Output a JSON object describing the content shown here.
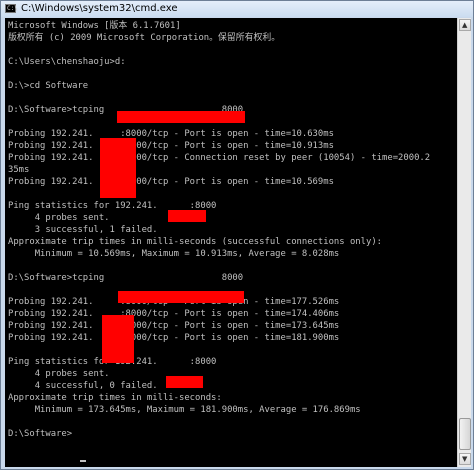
{
  "window": {
    "title": "C:\\Windows\\system32\\cmd.exe",
    "icon_label": "C:\\"
  },
  "console": {
    "lines": [
      "Microsoft Windows [版本 6.1.7601]",
      "版权所有 (c) 2009 Microsoft Corporation。保留所有权利。",
      "",
      "C:\\Users\\chenshaoju>d:",
      "",
      "D:\\>cd Software",
      "",
      "D:\\Software>tcping                      8000",
      "",
      "Probing 192.241.     :8000/tcp - Port is open - time=10.630ms",
      "Probing 192.241.     :8000/tcp - Port is open - time=10.913ms",
      "Probing 192.241.     :8000/tcp - Connection reset by peer (10054) - time=2000.2",
      "35ms",
      "Probing 192.241.     :8000/tcp - Port is open - time=10.569ms",
      "",
      "Ping statistics for 192.241.      :8000",
      "     4 probes sent.",
      "     3 successful, 1 failed.",
      "Approximate trip times in milli-seconds (successful connections only):",
      "     Minimum = 10.569ms, Maximum = 10.913ms, Average = 8.028ms",
      "",
      "D:\\Software>tcping                      8000",
      "",
      "Probing 192.241.     :8000/tcp - Port is open - time=177.526ms",
      "Probing 192.241.     :8000/tcp - Port is open - time=174.406ms",
      "Probing 192.241.     :8000/tcp - Port is open - time=173.645ms",
      "Probing 192.241.     :8000/tcp - Port is open - time=181.900ms",
      "",
      "Ping statistics for 192.241.      :8000",
      "     4 probes sent.",
      "     4 successful, 0 failed.",
      "Approximate trip times in milli-seconds:",
      "     Minimum = 173.645ms, Maximum = 181.900ms, Average = 176.869ms",
      "",
      "D:\\Software>"
    ]
  },
  "scrollbar": {
    "up_arrow": "▲",
    "down_arrow": "▼"
  },
  "colors": {
    "console_bg": "#000000",
    "console_text": "#c0c0c0",
    "redaction": "#ff0000"
  }
}
